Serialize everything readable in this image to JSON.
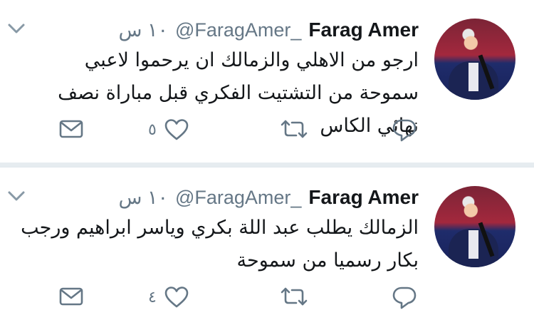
{
  "tweets": [
    {
      "name": "Farag Amer",
      "handle": "@FaragAmer_",
      "time": "١٠ س",
      "text": "ارجو من الاهلي والزمالك  ان يرحموا لاعبي سموحة من التشتيت الفكري قبل مباراة نصف نهائي  الكاس",
      "like_count": "٥",
      "icons": [
        "reply-icon",
        "retweet-icon",
        "like-icon",
        "mail-icon",
        "chevron-down-icon"
      ]
    },
    {
      "name": "Farag Amer",
      "handle": "@FaragAmer_",
      "time": "١٠ س",
      "text": "الزمالك يطلب  عبد اللة بكري وياسر ابراهيم  ورجب بكار رسميا من سموحة",
      "like_count": "٤",
      "icons": [
        "reply-icon",
        "retweet-icon",
        "like-icon",
        "mail-icon",
        "chevron-down-icon"
      ]
    }
  ],
  "colors": {
    "icon_gray": "#657786",
    "text": "#14171a",
    "divider": "#e6ecf0"
  }
}
